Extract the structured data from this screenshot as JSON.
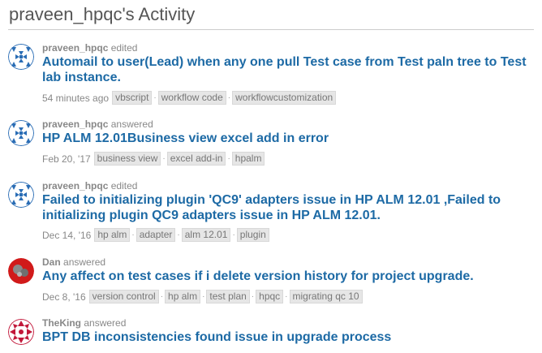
{
  "page": {
    "title": "praveen_hpqc's Activity"
  },
  "items": [
    {
      "user": "praveen_hpqc",
      "action": "edited",
      "title": "Automail to user(Lead) when any one pull Test case from Test paln tree to Test lab instance.",
      "time": "54 minutes ago",
      "tags": [
        "vbscript",
        "workflow code",
        "workflowcustomization"
      ],
      "avatar": "blue-pattern-avatar"
    },
    {
      "user": "praveen_hpqc",
      "action": "answered",
      "title": "HP ALM 12.01Business view excel add in error",
      "time": "Feb 20, '17",
      "tags": [
        "business view",
        "excel add-in",
        "hpalm"
      ],
      "avatar": "blue-pattern-avatar"
    },
    {
      "user": "praveen_hpqc",
      "action": "edited",
      "title": "Failed to initializing plugin 'QC9' adapters issue in HP ALM 12.01 ,Failed to initializing plugin QC9 adapters issue in HP ALM 12.01.",
      "time": "Dec 14, '16",
      "tags": [
        "hp alm",
        "adapter",
        "alm 12.01",
        "plugin"
      ],
      "avatar": "blue-pattern-avatar"
    },
    {
      "user": "Dan",
      "action": "answered",
      "title": "Any affect on test cases if i delete version history for project upgrade.",
      "time": "Dec 8, '16",
      "tags": [
        "version control",
        "hp alm",
        "test plan",
        "hpqc",
        "migrating qc 10"
      ],
      "avatar": "red-photo-avatar"
    },
    {
      "user": "TheKing",
      "action": "answered",
      "title": "BPT DB inconsistencies found issue in upgrade process",
      "time": "",
      "tags": [],
      "avatar": "red-pattern-avatar"
    }
  ]
}
